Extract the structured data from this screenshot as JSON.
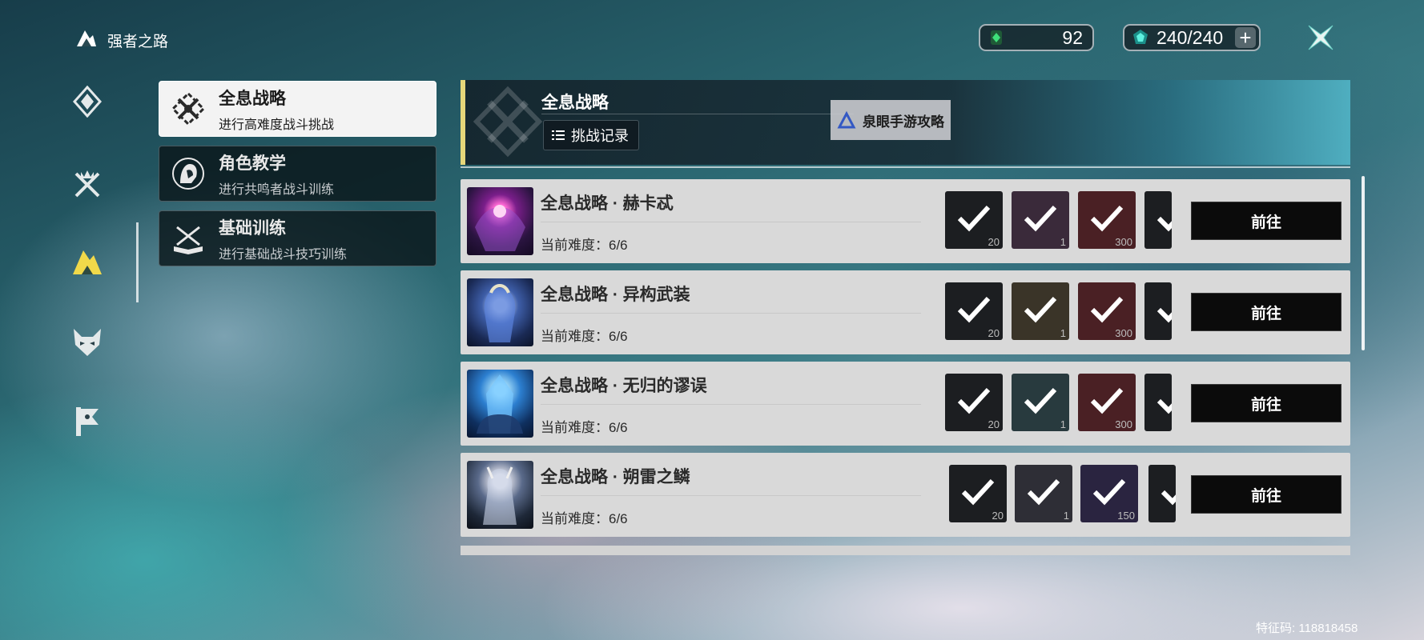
{
  "header": {
    "title": "强者之路",
    "currency1": {
      "icon": "green-crystal-icon",
      "value": "92"
    },
    "currency2": {
      "icon": "teal-gem-icon",
      "value": "240/240",
      "add_label": "+"
    }
  },
  "rail": {
    "items": [
      {
        "icon": "diamond-compass-icon",
        "active": false
      },
      {
        "icon": "crossed-swords-crown-icon",
        "active": false
      },
      {
        "icon": "strong-path-icon",
        "active": true
      },
      {
        "icon": "demon-mask-icon",
        "active": false
      },
      {
        "icon": "banner-icon",
        "active": false
      }
    ]
  },
  "menu": [
    {
      "title": "全息战略",
      "subtitle": "进行高难度战斗挑战",
      "icon": "holo-strategy-icon",
      "active": true
    },
    {
      "title": "角色教学",
      "subtitle": "进行共鸣者战斗训练",
      "icon": "character-portrait-icon",
      "active": false
    },
    {
      "title": "基础训练",
      "subtitle": "进行基础战斗技巧训练",
      "icon": "book-swords-icon",
      "active": false
    }
  ],
  "panel": {
    "title": "全息战略",
    "record_button": "挑战记录"
  },
  "watermark": {
    "text": "泉眼手游攻略"
  },
  "challenges": [
    {
      "title": "全息战略 · 赫卡忒",
      "difficulty": "当前难度：6/6",
      "rewards": [
        "20",
        "1",
        "300",
        ""
      ],
      "go": "前往"
    },
    {
      "title": "全息战略 · 异构武装",
      "difficulty": "当前难度：6/6",
      "rewards": [
        "20",
        "1",
        "300",
        ""
      ],
      "go": "前往"
    },
    {
      "title": "全息战略 · 无归的谬误",
      "difficulty": "当前难度：6/6",
      "rewards": [
        "20",
        "1",
        "300",
        ""
      ],
      "go": "前往"
    },
    {
      "title": "全息战略 · 朔雷之鳞",
      "difficulty": "当前难度：6/6",
      "rewards": [
        "20",
        "1",
        "150",
        ""
      ],
      "go": "前往"
    }
  ],
  "footer": {
    "feature_code": "特征码: 118818458"
  },
  "colors": {
    "accent": "#e6d77a",
    "active_icon": "#f1d94a",
    "row_bg": "#d9d9d9",
    "button_bg": "#0b0b0b"
  }
}
